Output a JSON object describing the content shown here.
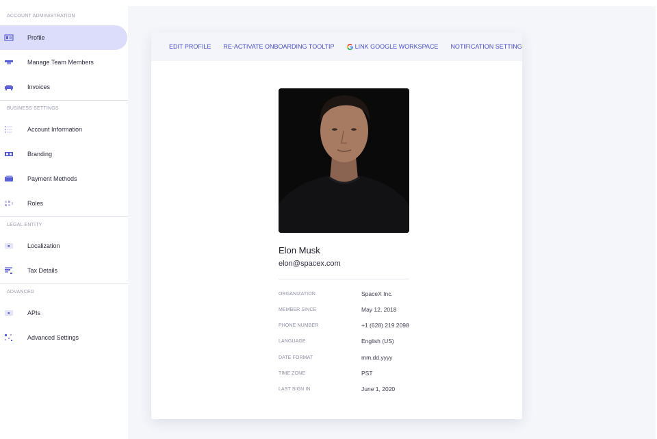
{
  "sidebar": {
    "sections": [
      {
        "title": "ACCOUNT ADMINISTRATION",
        "items": [
          {
            "label": "Profile",
            "icon": "profile-icon",
            "active": true
          },
          {
            "label": "Manage Team Members",
            "icon": "team-icon"
          },
          {
            "label": "Invoices",
            "icon": "invoice-icon"
          }
        ]
      },
      {
        "title": "BUSINESS SETTINGS",
        "items": [
          {
            "label": "Account Information",
            "icon": "list-icon"
          },
          {
            "label": "Branding",
            "icon": "branding-icon"
          },
          {
            "label": "Payment Methods",
            "icon": "card-icon"
          },
          {
            "label": "Roles",
            "icon": "roles-icon"
          }
        ]
      },
      {
        "title": "LEGAL ENTITY",
        "items": [
          {
            "label": "Localization",
            "icon": "localization-icon"
          },
          {
            "label": "Tax Details",
            "icon": "tax-icon"
          }
        ]
      },
      {
        "title": "ADVANCED",
        "items": [
          {
            "label": "APIs",
            "icon": "api-icon"
          },
          {
            "label": "Advanced Settings",
            "icon": "advanced-settings-icon"
          }
        ]
      }
    ]
  },
  "toolbar": {
    "edit_profile": "EDIT PROFILE",
    "reactivate": "RE-ACTIVATE ONBOARDING TOOLTIP",
    "link_google": "LINK GOOGLE WORKSPACE",
    "notifications": "NOTIFICATION SETTINGS"
  },
  "profile": {
    "name": "Elon Musk",
    "email": "elon@spacex.com",
    "details": [
      {
        "label": "ORGANIZATION",
        "value": "SpaceX Inc."
      },
      {
        "label": "MEMBER SINCE",
        "value": "May 12, 2018"
      },
      {
        "label": "PHONE NUMBER",
        "value": "+1 (628) 219 2098"
      },
      {
        "label": "LANGUAGE",
        "value": "English (US)"
      },
      {
        "label": "DATE FORMAT",
        "value": "mm.dd.yyyy"
      },
      {
        "label": "TIME ZONE",
        "value": "PST"
      },
      {
        "label": "LAST SIGN IN",
        "value": "June 1, 2020"
      }
    ]
  },
  "colors": {
    "accent": "#4a4ec4",
    "active_bg": "#dcdcfb",
    "page_bg": "#f5f6fa"
  }
}
